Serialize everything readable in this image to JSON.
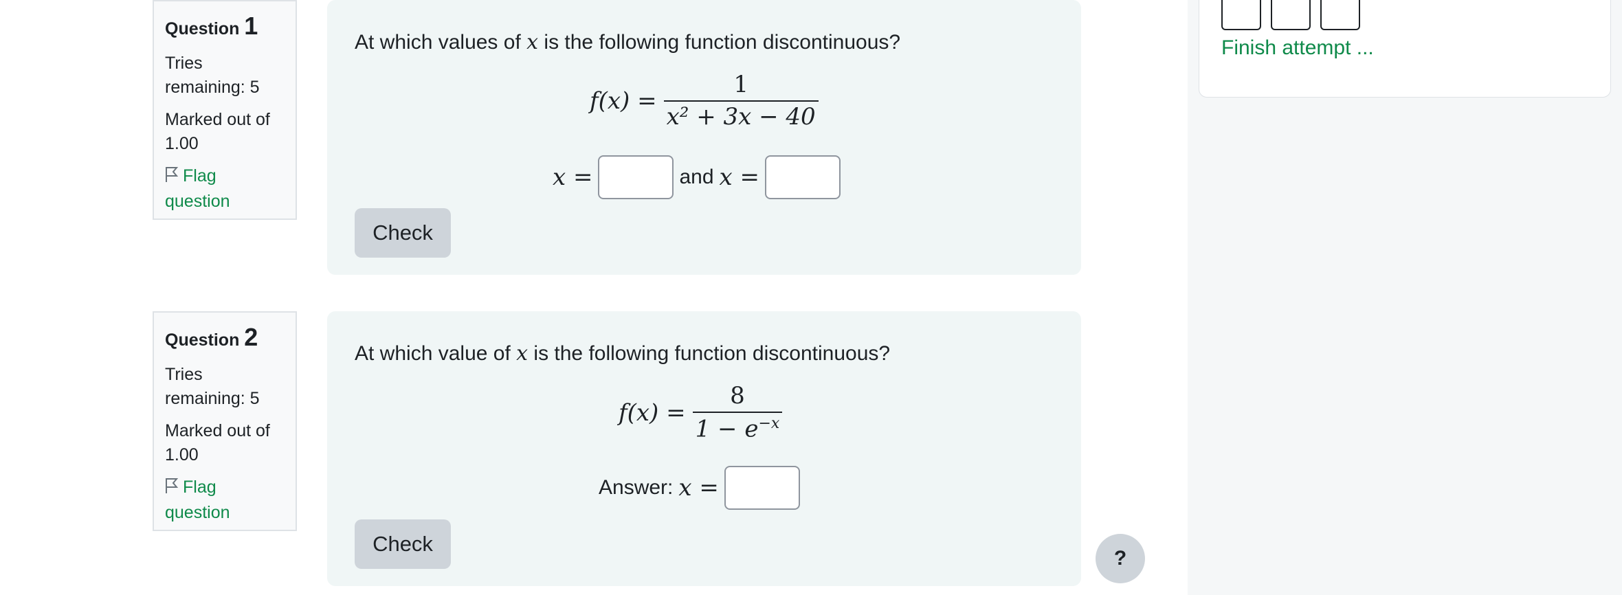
{
  "questions": [
    {
      "label": "Question",
      "number": "1",
      "tries": "Tries remaining: 5",
      "marked": "Marked out of 1.00",
      "flag": "Flag question",
      "text_before": "At which values of",
      "text_var": "x",
      "text_after": "is the following function discontinuous?",
      "formula": {
        "lhs": "f(x) =",
        "numerator": "1",
        "denominator": "x² + 3x − 40"
      },
      "answers": [
        {
          "prefix": "x =",
          "value": ""
        },
        {
          "joiner": "and",
          "prefix": "x =",
          "value": ""
        }
      ],
      "check_label": "Check"
    },
    {
      "label": "Question",
      "number": "2",
      "tries": "Tries remaining: 5",
      "marked": "Marked out of 1.00",
      "flag": "Flag question",
      "text_before": "At which value of",
      "text_var": "x",
      "text_after": "is the following function discontinuous?",
      "formula": {
        "lhs": "f(x) =",
        "numerator": "8",
        "denominator": "1 − e",
        "denominator_exponent": "−x"
      },
      "answers": [
        {
          "label": "Answer:",
          "prefix": "x =",
          "value": ""
        }
      ],
      "check_label": "Check"
    }
  ],
  "navigation": {
    "finish_label": "Finish attempt ..."
  },
  "help": {
    "label": "?"
  },
  "colors": {
    "link_green": "#0f8a4a",
    "content_bg": "#f0f6f6",
    "info_bg": "#f8f9fa",
    "drawer_bg": "#f5f7f8",
    "button_grey": "#ced4da"
  },
  "icons": {
    "flag": "flag-icon",
    "help": "question-mark-icon"
  }
}
